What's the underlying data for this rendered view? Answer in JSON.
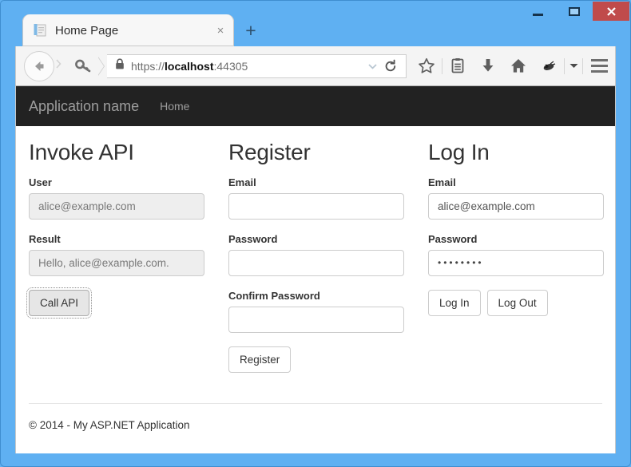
{
  "window": {
    "controls": {
      "minimize": "−",
      "maximize": "▢",
      "close": "✕"
    },
    "frame_color": "#5fb0f2",
    "close_color": "#c04b4b"
  },
  "browser": {
    "tab": {
      "title": "Home Page",
      "close_label": "×",
      "favicon": "document-icon"
    },
    "new_tab_label": "+",
    "toolbar": {
      "back_icon": "back-arrow-icon",
      "forward_icon": "forward-chevron-icon",
      "identity_icon": "key-icon",
      "lock_icon": "lock-icon",
      "url_scheme": "https://",
      "url_host": "localhost",
      "url_port": ":44305",
      "url_full": "https://localhost:44305",
      "url_dropdown_icon": "chevron-down-icon",
      "reload_icon": "reload-icon",
      "icons": [
        "bookmark-star-icon",
        "reader-list-icon",
        "download-arrow-icon",
        "home-icon",
        "extension-icon",
        "chevron-down-icon",
        "hamburger-menu-icon"
      ]
    }
  },
  "site": {
    "navbar": {
      "brand": "Application name",
      "links": [
        {
          "label": "Home"
        }
      ]
    },
    "columns": [
      {
        "id": "invoke-api",
        "title": "Invoke API",
        "fields": [
          {
            "id": "user",
            "label": "User",
            "value": "alice@example.com",
            "readonly": true,
            "type": "text"
          },
          {
            "id": "result",
            "label": "Result",
            "value": "Hello, alice@example.com.",
            "readonly": true,
            "type": "text"
          }
        ],
        "buttons": [
          {
            "id": "call-api",
            "label": "Call API",
            "focused": true
          }
        ]
      },
      {
        "id": "register",
        "title": "Register",
        "fields": [
          {
            "id": "register-email",
            "label": "Email",
            "value": "",
            "readonly": false,
            "type": "text"
          },
          {
            "id": "register-password",
            "label": "Password",
            "value": "",
            "readonly": false,
            "type": "password"
          },
          {
            "id": "register-confirm-password",
            "label": "Confirm Password",
            "value": "",
            "readonly": false,
            "type": "password"
          }
        ],
        "buttons": [
          {
            "id": "register",
            "label": "Register",
            "focused": false
          }
        ]
      },
      {
        "id": "log-in",
        "title": "Log In",
        "fields": [
          {
            "id": "login-email",
            "label": "Email",
            "value": "alice@example.com",
            "readonly": false,
            "type": "text"
          },
          {
            "id": "login-password",
            "label": "Password",
            "value": "••••••••",
            "readonly": false,
            "type": "password"
          }
        ],
        "buttons": [
          {
            "id": "log-in",
            "label": "Log In",
            "focused": false
          },
          {
            "id": "log-out",
            "label": "Log Out",
            "focused": false
          }
        ]
      }
    ],
    "footer": {
      "text": "© 2014 - My ASP.NET Application"
    }
  }
}
